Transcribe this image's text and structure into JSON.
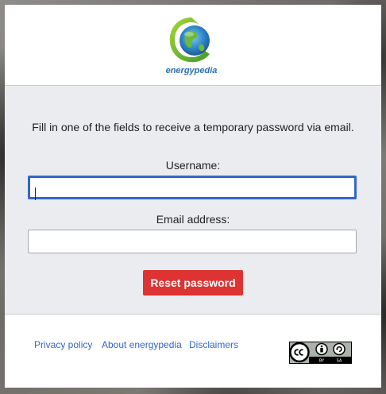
{
  "brand": {
    "logo_text": "energypedia"
  },
  "form": {
    "intro_text": "Fill in one of the fields to receive a temporary password via email.",
    "username_label": "Username:",
    "username_value": "",
    "email_label": "Email address:",
    "email_value": "",
    "submit_label": "Reset password"
  },
  "footer": {
    "links": [
      {
        "label": "Privacy policy"
      },
      {
        "label": "About energypedia"
      },
      {
        "label": "Disclaimers"
      }
    ],
    "license_badge": {
      "icons": [
        "cc-icon",
        "by-icon",
        "sa-icon"
      ],
      "text_by": "BY",
      "text_sa": "SA"
    }
  },
  "colors": {
    "accent_link": "#3366cc",
    "button_red": "#dd3333",
    "panel_gray": "#eaecf0",
    "focus_blue": "#3366cc"
  }
}
